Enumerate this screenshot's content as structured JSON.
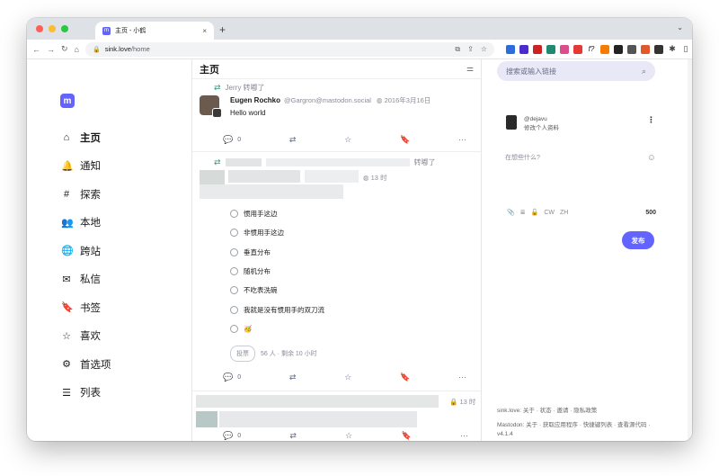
{
  "browser": {
    "tab_title": "主页 - 小鹤",
    "tab_favicon": "m",
    "close_glyph": "×",
    "new_tab_glyph": "+",
    "url_host": "sink.love",
    "url_path": "/home"
  },
  "sidebar": {
    "logo_glyph": "m",
    "items": [
      {
        "label": "主页",
        "icon": "⌂"
      },
      {
        "label": "通知",
        "icon": "🔔"
      },
      {
        "label": "探索",
        "icon": "#"
      },
      {
        "label": "本地",
        "icon": "👥"
      },
      {
        "label": "跨站",
        "icon": "🌐"
      },
      {
        "label": "私信",
        "icon": "✉"
      },
      {
        "label": "书签",
        "icon": "🔖"
      },
      {
        "label": "喜欢",
        "icon": "☆"
      },
      {
        "label": "首选项",
        "icon": "⚙"
      },
      {
        "label": "列表",
        "icon": "☰"
      }
    ]
  },
  "timeline": {
    "title": "主页",
    "post1": {
      "boosted_by": "Jerry 转嘟了",
      "author_name": "Eugen Rochko",
      "author_acct": "@Gargron@mastodon.social",
      "date": "2016年3月16日",
      "body": "Hello world",
      "reply_count": "0"
    },
    "post2": {
      "boosted_suffix": "转嘟了",
      "time": "13 时",
      "poll_options": [
        "惯用手这边",
        "非惯用手这边",
        "垂直分布",
        "随机分布",
        "不吃表洗碗",
        "我就是没有惯用手的双刀流",
        "🥳"
      ],
      "vote_label": "投票",
      "poll_meta": "56 人 · 剩余 10 小时",
      "reply_count": "0"
    },
    "post3": {
      "time": "13 时",
      "reply_count": "0"
    }
  },
  "right": {
    "search_placeholder": "搜索或输入链接",
    "me_handle": "@dejavu",
    "me_edit": "修改个人资料",
    "compose_placeholder": "在想些什么?",
    "cw": "CW",
    "lang": "ZH",
    "char_count": "500",
    "publish": "发布",
    "footer_line1": "sink.love: 关于 · 状态 · 邀请 · 隐私政策",
    "footer_line2": "Mastodon: 关于 · 获取应用程序 · 快捷键列表 · 查看源代码 · v4.1.4"
  },
  "colors": {
    "accent": "#6364ff",
    "boost": "#2e9a7a"
  }
}
